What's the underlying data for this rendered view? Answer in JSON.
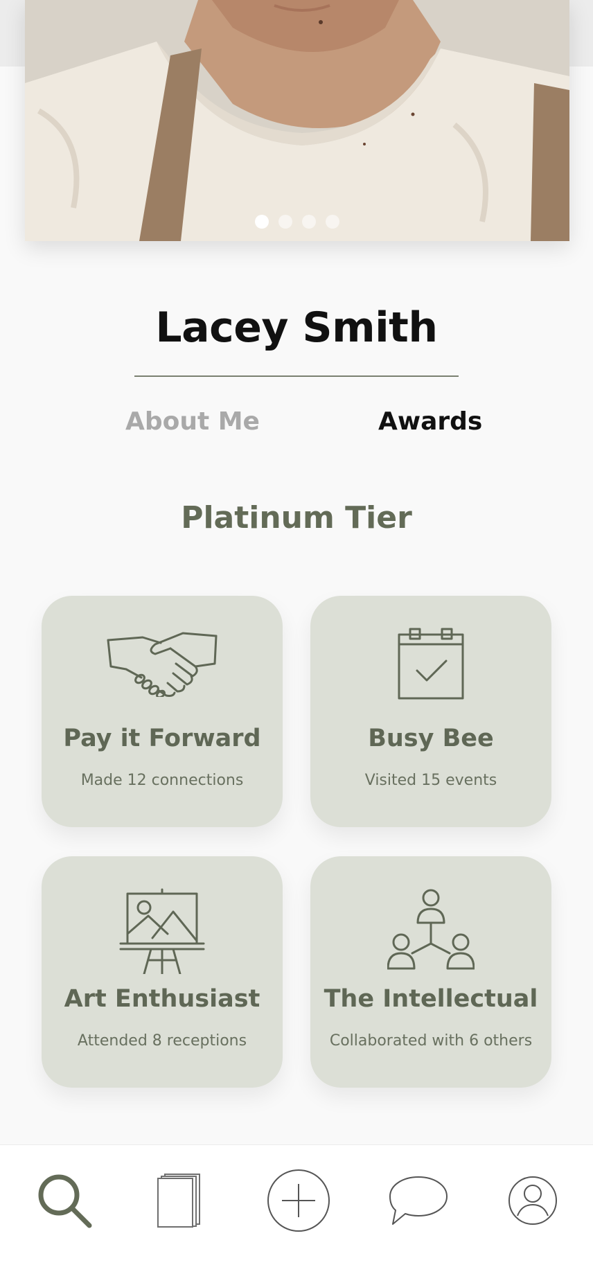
{
  "profile": {
    "name": "Lacey Smith",
    "photo_dots_count": 4,
    "active_photo_index": 0
  },
  "tabs": [
    {
      "label": "About Me",
      "active": false
    },
    {
      "label": "Awards",
      "active": true
    }
  ],
  "tier": "Platinum Tier",
  "awards": [
    {
      "icon": "handshake-icon",
      "title": "Pay it Forward",
      "desc": "Made 12 connections"
    },
    {
      "icon": "calendar-check-icon",
      "title": "Busy Bee",
      "desc": "Visited 15 events"
    },
    {
      "icon": "easel-painting-icon",
      "title": "Art Enthusiast",
      "desc": "Attended 8 receptions"
    },
    {
      "icon": "network-people-icon",
      "title": "The Intellectual",
      "desc": "Collaborated with 6 others"
    }
  ],
  "bottom_nav": [
    {
      "icon": "search-icon",
      "active": true
    },
    {
      "icon": "pages-icon",
      "active": false
    },
    {
      "icon": "add-circle-icon",
      "active": false
    },
    {
      "icon": "chat-bubble-icon",
      "active": false
    },
    {
      "icon": "profile-icon",
      "active": false
    }
  ],
  "colors": {
    "accent": "#636b57",
    "card_bg": "#dcdfd6",
    "inactive_tab": "#a9a9a9",
    "background": "#f9f9f9"
  }
}
